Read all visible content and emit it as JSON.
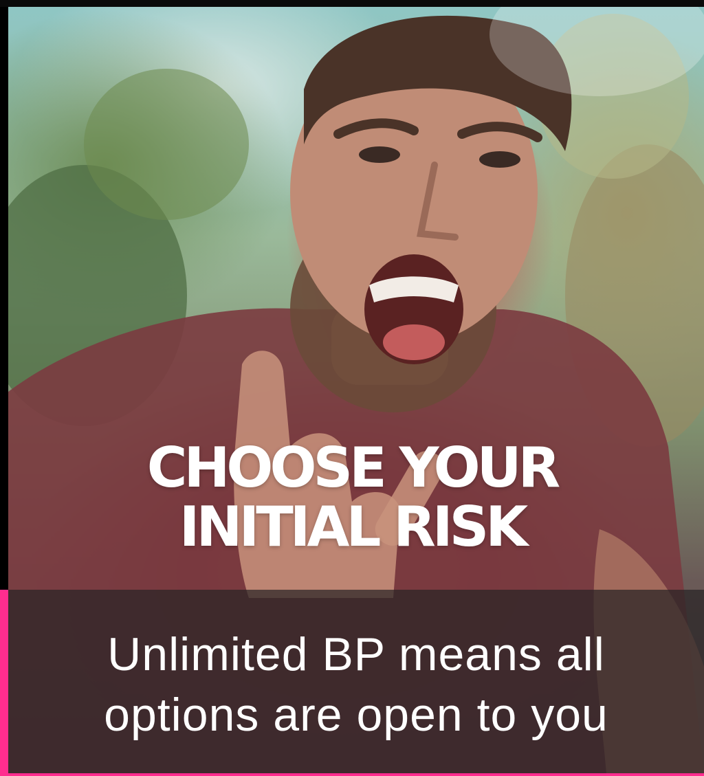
{
  "headline": {
    "line1": "CHOOSE YOUR",
    "line2": "INITIAL RISK"
  },
  "caption": {
    "line1": "Unlimited BP means all",
    "line2": "options are open to you"
  },
  "colors": {
    "accent": "#ff2d8f",
    "text": "#ffffff",
    "band": "#282426"
  }
}
